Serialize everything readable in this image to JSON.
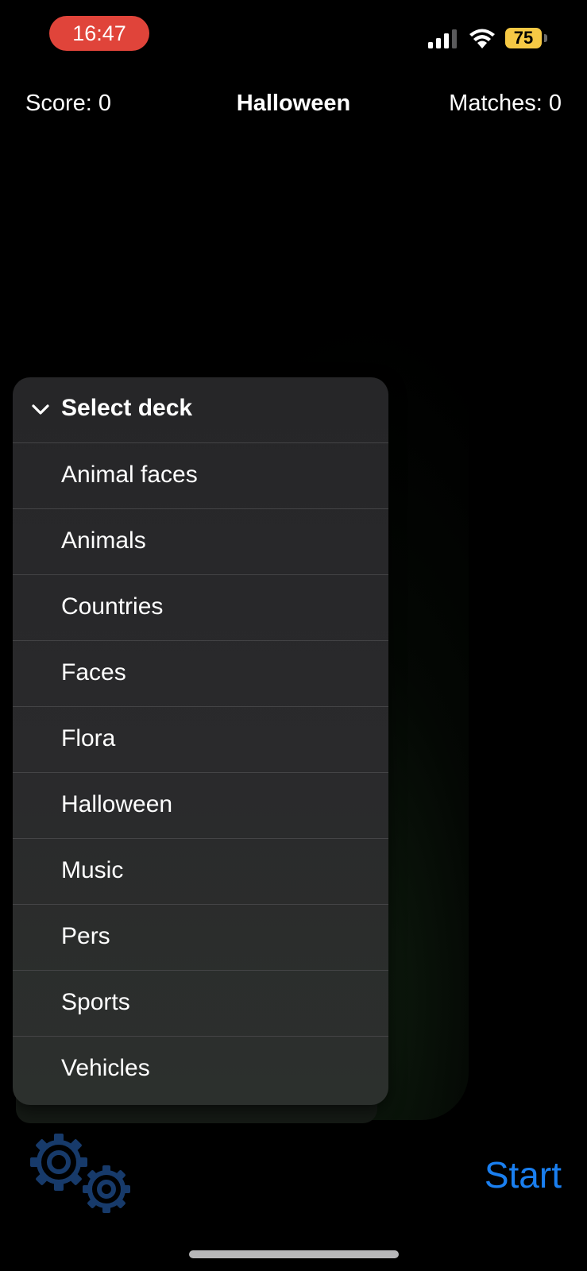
{
  "status_bar": {
    "time": "16:47",
    "battery_level": "75",
    "colors": {
      "time_pill": "#e0443a",
      "battery": "#f6c945"
    },
    "icons": [
      "cellular-signal-icon",
      "wifi-icon",
      "battery-icon"
    ]
  },
  "header": {
    "score": "Score: 0",
    "title": "Halloween",
    "matches": "Matches: 0"
  },
  "deck_menu": {
    "title": "Select deck",
    "icon": "chevron-down-icon",
    "items": [
      "Animal faces",
      "Animals",
      "Countries",
      "Faces",
      "Flora",
      "Halloween",
      "Music",
      "Pers",
      "Sports",
      "Vehicles"
    ]
  },
  "controls": {
    "settings_icon": "gears-icon",
    "start_label": "Start",
    "accent_color": "#1a7ff0",
    "settings_color": "#173a6a"
  }
}
